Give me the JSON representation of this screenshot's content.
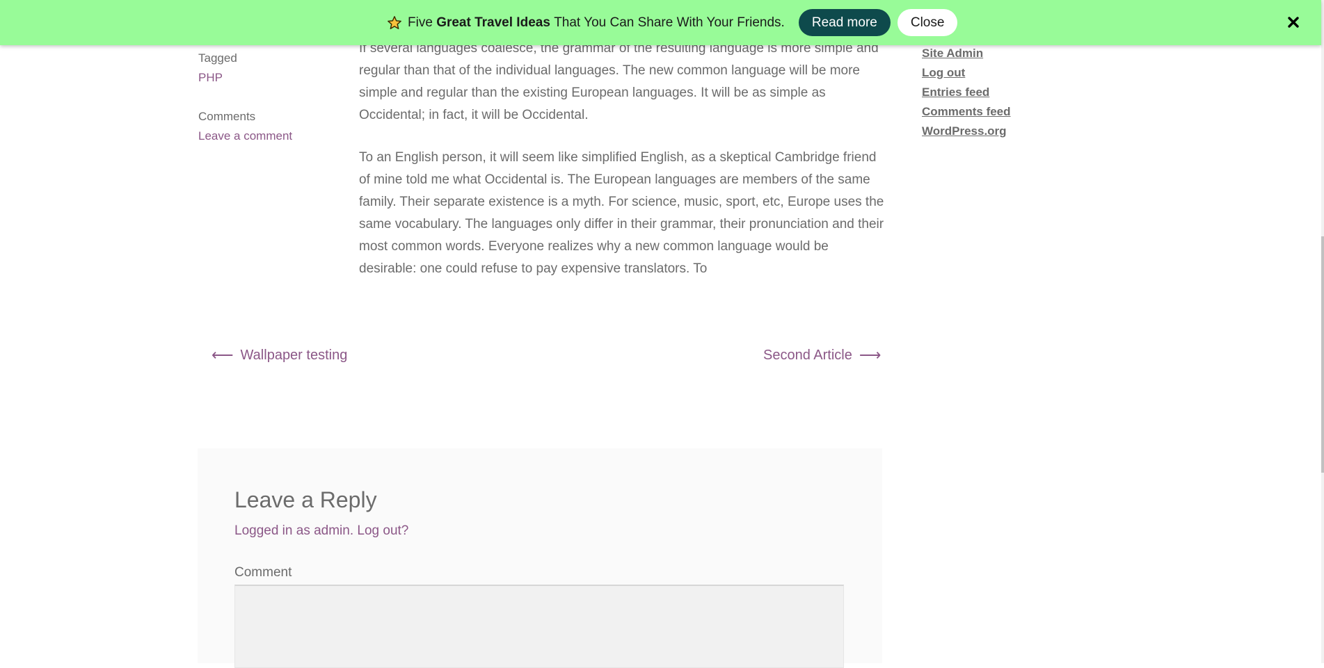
{
  "banner": {
    "icon": "star-icon",
    "text_prefix": "Five",
    "text_bold": "Great Travel Ideas",
    "text_suffix": "That You Can Share With Your Friends.",
    "read_more_label": "Read more",
    "close_label": "Close",
    "dismiss_icon": "close-x-icon",
    "background": "#98fb98",
    "button_color": "#0e4a4c"
  },
  "post_meta": {
    "tagged_label": "Tagged",
    "tag": "PHP",
    "comments_label": "Comments",
    "comments_link": "Leave a comment"
  },
  "content": {
    "paragraphs": [
      "If several languages coalesce, the grammar of the resulting language is more simple and regular than that of the individual languages. The new common language will be more simple and regular than the existing European languages. It will be as simple as Occidental; in fact, it will be Occidental.",
      "To an English person, it will seem like simplified English, as a skeptical Cambridge friend of mine told me what Occidental is. The European languages are members of the same family. Their separate existence is a myth. For science, music, sport, etc, Europe uses the same vocabulary. The languages only differ in their grammar, their pronunciation and their most common words. Everyone realizes why a new common language would be desirable: one could refuse to pay expensive translators. To"
    ]
  },
  "post_nav": {
    "prev_label": "Wallpaper testing",
    "prev_icon": "arrow-left-icon",
    "next_label": "Second Article",
    "next_icon": "arrow-right-icon"
  },
  "sidebar": {
    "links": [
      "Site Admin",
      "Log out",
      "Entries feed",
      "Comments feed",
      "WordPress.org"
    ]
  },
  "reply": {
    "title": "Leave a Reply",
    "logged_in_text": "Logged in as admin. Log out?",
    "comment_label": "Comment",
    "comment_value": ""
  },
  "colors": {
    "link": "#8b5787",
    "text": "#6b6b6b",
    "reply_bg": "#fafafa"
  }
}
